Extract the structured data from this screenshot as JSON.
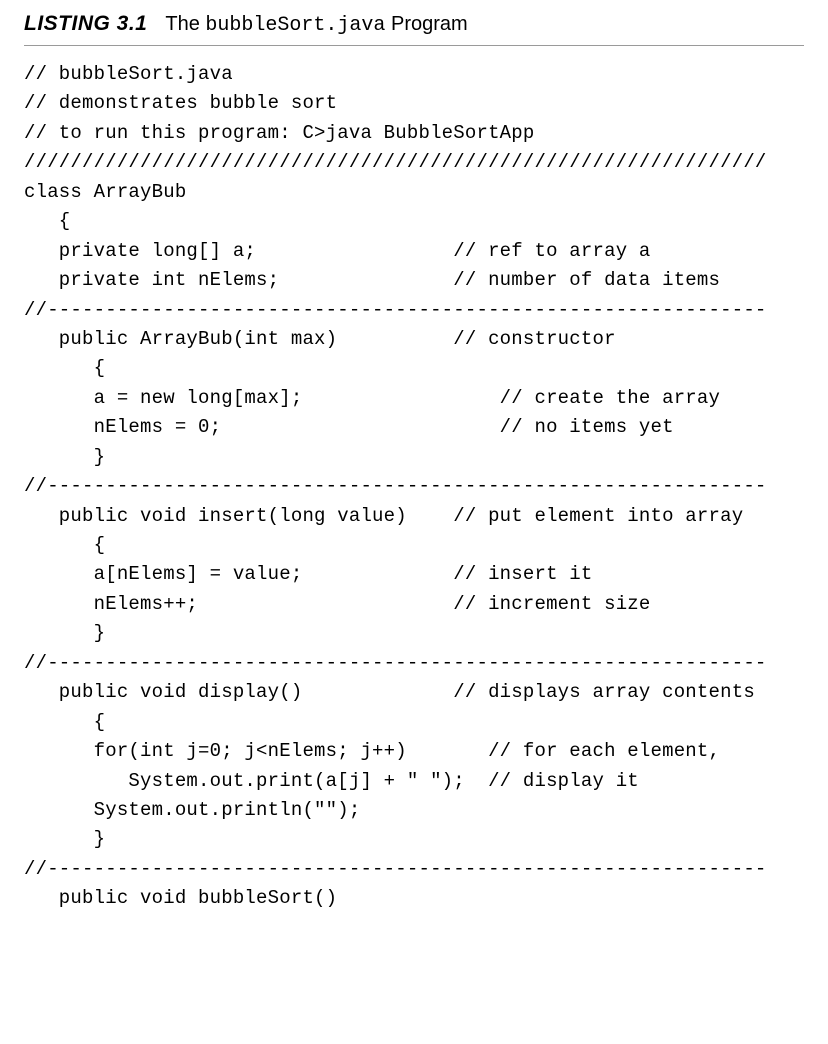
{
  "listing": {
    "label": "LISTING 3.1",
    "title_prefix": "The ",
    "title_code": "bubbleSort.java",
    "title_suffix": " Program"
  },
  "code": "// bubbleSort.java\n// demonstrates bubble sort\n// to run this program: C>java BubbleSortApp\n////////////////////////////////////////////////////////////////\nclass ArrayBub\n   {\n   private long[] a;                 // ref to array a\n   private int nElems;               // number of data items\n//--------------------------------------------------------------\n   public ArrayBub(int max)          // constructor\n      {\n      a = new long[max];                 // create the array\n      nElems = 0;                        // no items yet\n      }\n//--------------------------------------------------------------\n   public void insert(long value)    // put element into array\n      {\n      a[nElems] = value;             // insert it\n      nElems++;                      // increment size\n      }\n//--------------------------------------------------------------\n   public void display()             // displays array contents\n      {\n      for(int j=0; j<nElems; j++)       // for each element,\n         System.out.print(a[j] + \" \");  // display it\n      System.out.println(\"\");\n      }\n//--------------------------------------------------------------\n   public void bubbleSort()"
}
